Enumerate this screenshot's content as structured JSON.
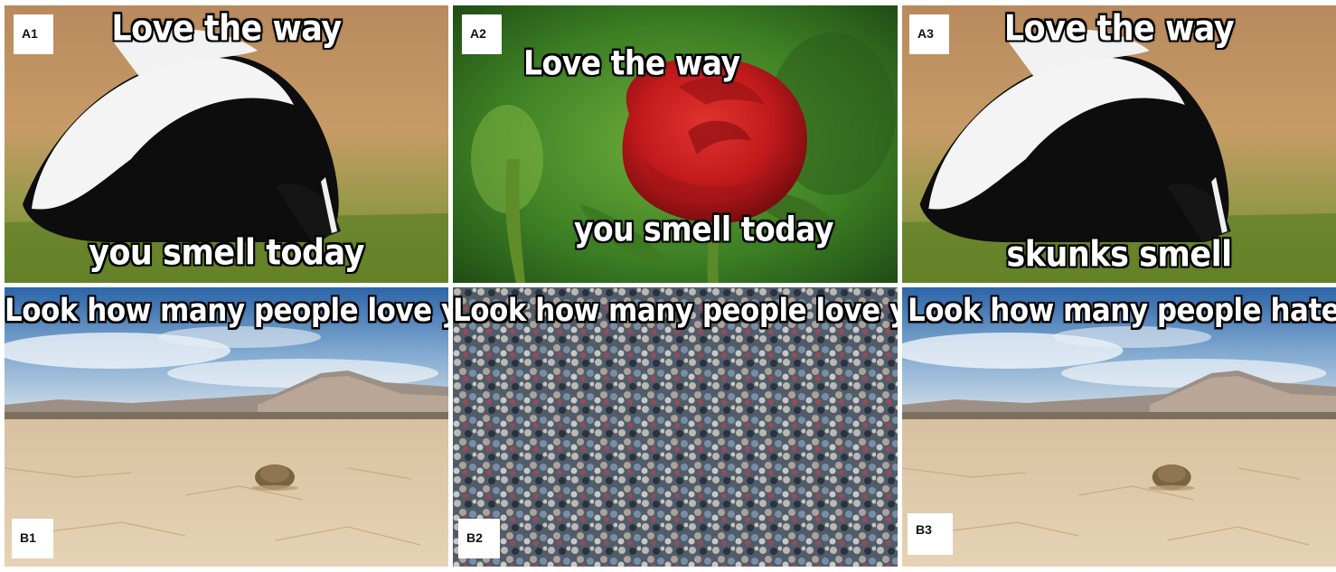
{
  "panels": {
    "a1": {
      "label": "A1",
      "top_text": "Love the way",
      "bottom_text": "you smell today"
    },
    "a2": {
      "label": "A2",
      "top_text": "Love the way",
      "bottom_text": "you smell today"
    },
    "a3": {
      "label": "A3",
      "top_text": "Love the way",
      "bottom_text": "skunks smell"
    },
    "b1": {
      "label": "B1",
      "top_text": "Look how many people love you"
    },
    "b2": {
      "label": "B2",
      "top_text": "Look how many people love you"
    },
    "b3": {
      "label": "B3",
      "top_text": "Look how many people hate you"
    }
  }
}
